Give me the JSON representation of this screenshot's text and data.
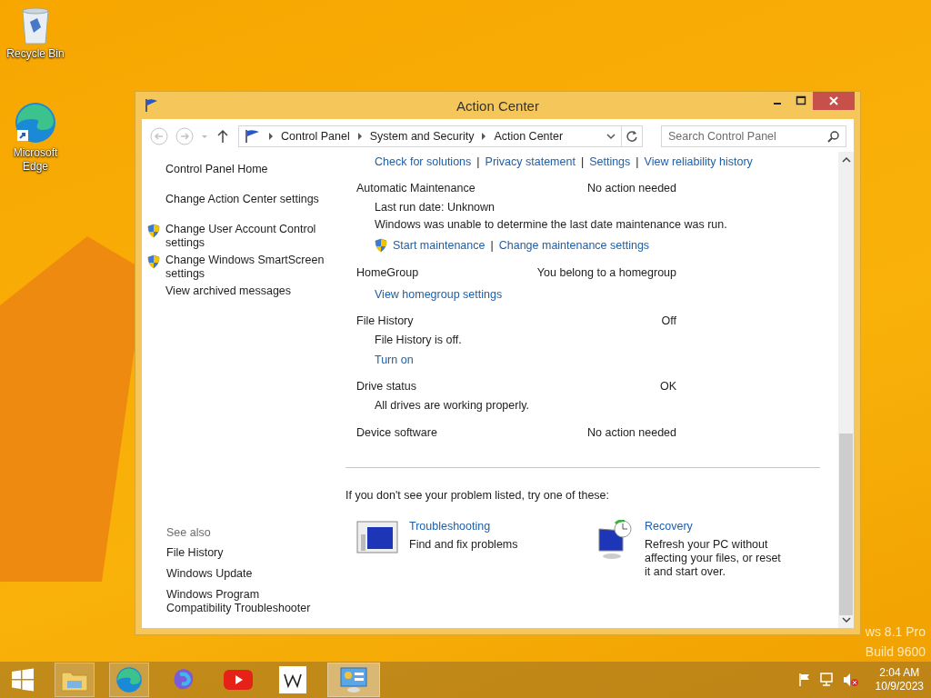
{
  "desktop_icons": [
    {
      "kind": "recycle-bin",
      "label": "Recycle Bin"
    },
    {
      "kind": "edge",
      "label": "Microsoft Edge"
    }
  ],
  "os_watermark": [
    "ws 8.1 Pro",
    "Build 9600"
  ],
  "window": {
    "title": "Action Center"
  },
  "address_bar": {
    "breadcrumbs": [
      "Control Panel",
      "System and Security",
      "Action Center"
    ],
    "search": {
      "placeholder": "Search Control Panel"
    }
  },
  "sidebar": {
    "items": [
      {
        "label": "Control Panel Home",
        "shield": false
      },
      {
        "label": "Change Action Center settings",
        "shield": false
      },
      {
        "label": "Change User Account Control settings",
        "shield": true
      },
      {
        "label": "Change Windows SmartScreen settings",
        "shield": true
      },
      {
        "label": "View archived messages",
        "shield": false
      }
    ],
    "see_also": {
      "heading": "See also",
      "items": [
        "File History",
        "Windows Update",
        "Windows Program Compatibility Troubleshooter"
      ]
    }
  },
  "main": {
    "top_links": [
      {
        "kind": "link",
        "text": "Check for solutions"
      },
      {
        "kind": "separator",
        "text": "|"
      },
      {
        "kind": "link",
        "text": "Privacy statement"
      },
      {
        "kind": "separator",
        "text": "|"
      },
      {
        "kind": "link",
        "text": "Settings"
      },
      {
        "kind": "separator",
        "text": "|"
      },
      {
        "kind": "link",
        "text": "View reliability history"
      }
    ],
    "sections": [
      {
        "title": "Automatic Maintenance",
        "status": "No action needed",
        "details": [
          {
            "kind": "text",
            "text": "Last run date: Unknown"
          },
          {
            "kind": "text",
            "text": "Windows was unable to determine the last date maintenance was run."
          },
          {
            "kind": "links",
            "links": [
              {
                "kind": "link",
                "text": "Start maintenance",
                "shield": true
              },
              {
                "kind": "separator",
                "text": "|"
              },
              {
                "kind": "link",
                "text": "Change maintenance settings",
                "shield": false
              }
            ]
          }
        ]
      },
      {
        "title": "HomeGroup",
        "status": "You belong to a homegroup",
        "details": [
          {
            "kind": "links",
            "links": [
              {
                "kind": "link",
                "text": "View homegroup settings",
                "shield": false
              }
            ]
          }
        ]
      },
      {
        "title": "File History",
        "status": "Off",
        "details": [
          {
            "kind": "text",
            "text": "File History is off."
          },
          {
            "kind": "links",
            "links": [
              {
                "kind": "link",
                "text": "Turn on",
                "shield": false
              }
            ]
          }
        ]
      },
      {
        "title": "Drive status",
        "status": "OK",
        "details": [
          {
            "kind": "text",
            "text": "All drives are working properly."
          }
        ]
      },
      {
        "title": "Device software",
        "status": "No action needed"
      }
    ],
    "prompt": "If you don't see your problem listed, try one of these:",
    "tools": [
      {
        "kind": "troubleshooting",
        "title": "Troubleshooting",
        "description": "Find and fix problems"
      },
      {
        "kind": "recovery",
        "title": "Recovery",
        "description": "Refresh your PC without affecting your files, or reset it and start over."
      }
    ]
  },
  "taskbar": {
    "apps": [
      {
        "kind": "file-explorer",
        "running": true,
        "selected": false
      },
      {
        "kind": "edge",
        "running": true,
        "selected": false
      },
      {
        "kind": "copilot",
        "running": false,
        "selected": false
      },
      {
        "kind": "youtube",
        "running": false,
        "selected": false
      },
      {
        "kind": "wikipedia",
        "running": false,
        "selected": false
      },
      {
        "kind": "control-panel",
        "running": true,
        "selected": true
      }
    ],
    "clock": {
      "time": "2:04 AM",
      "date": "10/9/2023"
    }
  }
}
